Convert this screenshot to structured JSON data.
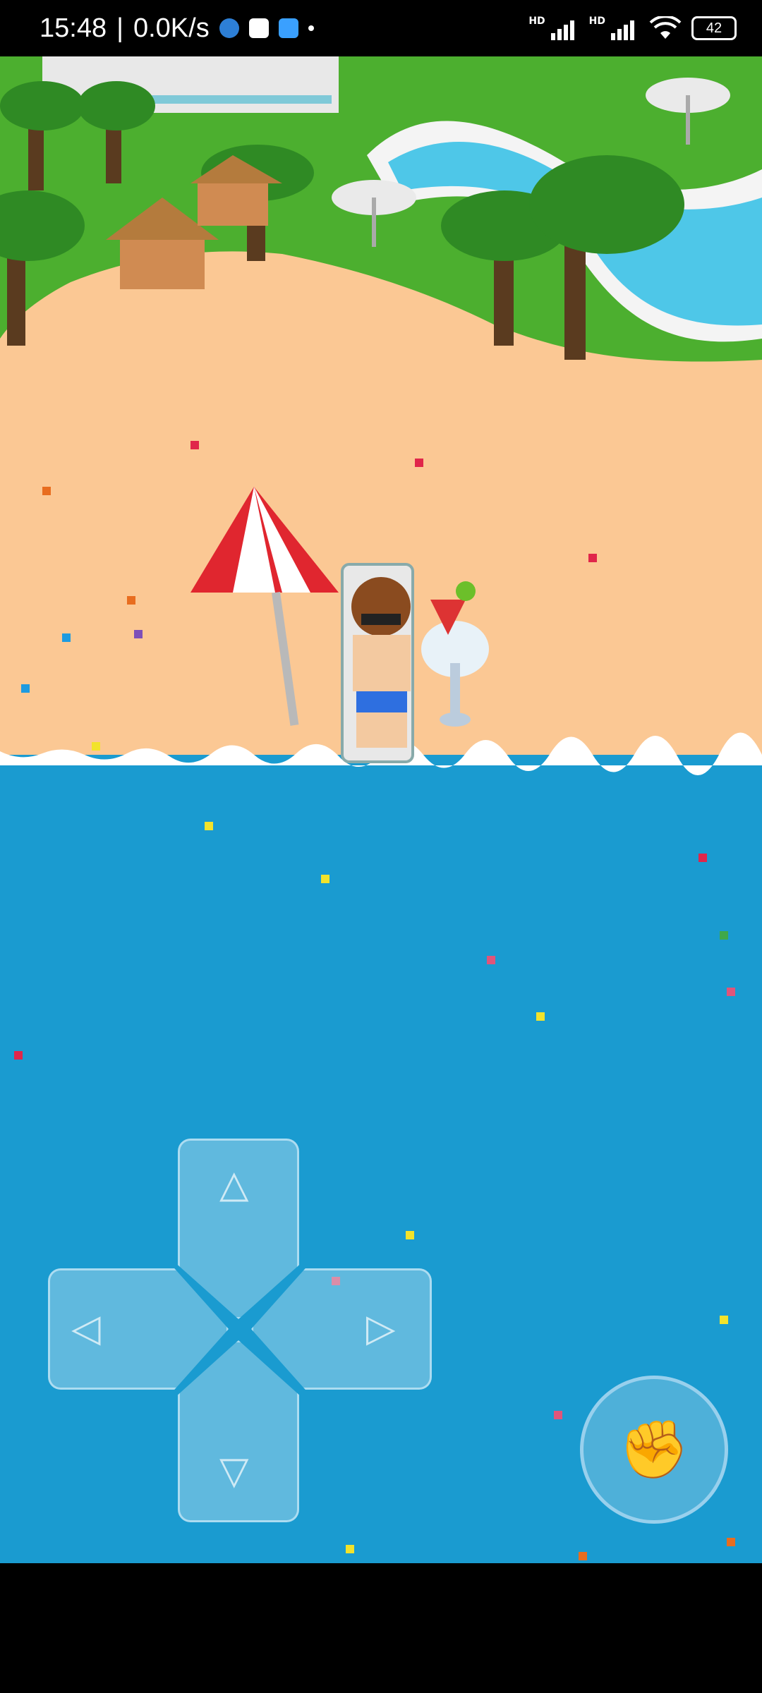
{
  "status_bar": {
    "time": "15:48",
    "separator": "|",
    "net_speed": "0.0K/s",
    "hd1": "HD",
    "hd2": "HD",
    "battery": "42"
  },
  "icons": {
    "punch": "fist-icon",
    "dpad_up": "triangle-up-icon",
    "dpad_down": "triangle-down-icon",
    "dpad_left": "triangle-left-icon",
    "dpad_right": "triangle-right-icon"
  },
  "colors": {
    "sea": "#1a9bd0",
    "sand": "#fbc894",
    "grass": "#4caf2f",
    "umbrella_red": "#e0262f"
  }
}
